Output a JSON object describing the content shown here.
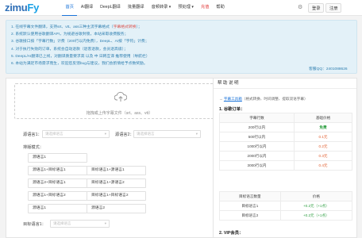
{
  "header": {
    "logo_main": "zimu",
    "logo_accent": "Fy",
    "nav": [
      {
        "label": "首页",
        "active": true
      },
      {
        "label": "AI翻译"
      },
      {
        "label": "DeepL翻译"
      },
      {
        "label": "批量翻译"
      },
      {
        "label": "音频转录 ▾"
      },
      {
        "label": "预处理 ▾"
      },
      {
        "label": "充值",
        "hot": true
      },
      {
        "label": "帮助"
      }
    ],
    "login_label": "登录",
    "register_label": "注册",
    "settings_icon": "gear-icon"
  },
  "notice": {
    "lines": [
      "1. 在线字幕文件翻译，支持srt、vtt、ass三种主流字幕格式（字幕格式转换）；",
      "2. 系统默认使用谷歌翻译API，为规避谷歌封锁，本站采取收费服务；",
      "3. 谷歌接口按「字幕行数」计费（200行以内免费），DeepL、AI按「字符」计费；",
      "4. 对于执行失败的订单，系统会自动退款（退客退款，会员退高级）；",
      "5. DeepL/AI翻译已上线，对翻译质量要求高 以及 中 日韩互译 推荐使用（导航栏）",
      "6. 本站为满足市场需求而生，欢迎您反馈bug与建议，我们会酌情给予点数奖励。"
    ],
    "link_text": "字幕格式转换",
    "contact": "客服QQ：2401088626"
  },
  "upload": {
    "text": "拖拽或上传字幕文件（srt、ass、vtt）",
    "icon": "cloud-upload-icon"
  },
  "form": {
    "source_label": "源语言1：",
    "source_placeholder": "请选择语言",
    "source2_label": "源语言2：",
    "source2_placeholder": "请选择语言",
    "layout_label": "排版模式：",
    "target_label": "目标语言1：",
    "target_placeholder": "请选择语言",
    "layout_options": [
      "源语言1",
      "源语言1+目标语言1",
      "目标语言1+源语言1",
      "源语言2+目标语言1",
      "目标语言1+源语言2",
      "源语言1+目标语言2",
      "目标语言1+目标语言2",
      "源语言1",
      "源语言2"
    ]
  },
  "help": {
    "title": "帮助说明",
    "tool_link": "字幕工具箱",
    "tool_desc": "（格式转换、时间调整、提取双语字幕）",
    "section1": "1. 谷歌订单：",
    "table1_head": [
      "字幕行数",
      "基础价格"
    ],
    "table1_rows": [
      [
        "200行以内",
        "免费"
      ],
      [
        "500行以内",
        "0.1元"
      ],
      [
        "1000行以内",
        "0.2元"
      ],
      [
        "2000行以内",
        "0.3元"
      ],
      [
        "3000行以内",
        "0.4元"
      ]
    ],
    "table2_head": [
      "目标语言数量",
      "价格"
    ],
    "table2_rows": [
      [
        "目标语言1",
        "+0.2元（+1点）"
      ],
      [
        "目标语言2",
        "+0.2元（+1点）"
      ]
    ],
    "section2": "2. VIP会员："
  }
}
